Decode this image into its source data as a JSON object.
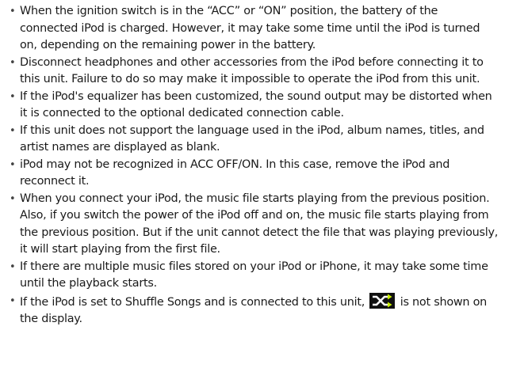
{
  "notes": [
    "When the ignition switch is in the “ACC” or “ON” position, the battery of the connected iPod is charged. However, it may take some time until the iPod is turned on, depending on the remaining power in the battery.",
    "Disconnect headphones and other accessories from the iPod before connecting it to this unit. Failure to do so may make it impossible to operate the iPod from this unit.",
    "If the iPod's equalizer has been customized, the sound output may be distorted when it is connected to the optional dedicated connection cable.",
    "If this unit does not support the language used in the iPod, album names, titles, and artist names are displayed as blank.",
    "iPod may not be recognized in ACC OFF/ON. In this case, remove the iPod and reconnect it.",
    "When you connect your iPod, the music file starts playing from the previous position. Also, if you switch the power of the iPod off and on, the music file starts playing from the previous position. But if the unit cannot detect the file that was playing previously, it will start playing from the first file.",
    "If there are multiple music files stored on your iPod or iPhone, it may take some time until the playback starts."
  ],
  "last_note": {
    "before_icon": "If the iPod is set to Shuffle Songs and is connected to this unit,",
    "after_icon": "is not shown on the display.",
    "icon": "shuffle-icon"
  },
  "bullet_char": "•",
  "colors": {
    "text": "#1a1a1a",
    "icon_bg": "#111111",
    "icon_arrow": "#c8f000"
  }
}
